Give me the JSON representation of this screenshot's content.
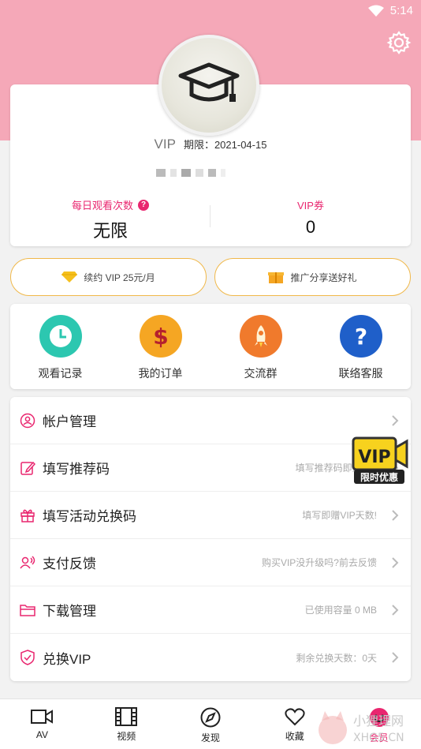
{
  "status": {
    "time": "5:14"
  },
  "profile": {
    "vip_label": "VIP",
    "expire_text": "期限：2021-04-15",
    "stats": [
      {
        "label": "每日观看次数",
        "value": "无限"
      },
      {
        "label": "VIP券",
        "value": "0"
      }
    ]
  },
  "promos": [
    {
      "label": "续约 VIP 25元/月",
      "icon": "diamond-icon"
    },
    {
      "label": "推广分享送好礼",
      "icon": "gift-box-icon"
    }
  ],
  "quick_actions": [
    {
      "label": "观看记录",
      "icon": "clock-icon",
      "color": "#2cc7b0"
    },
    {
      "label": "我的订单",
      "icon": "dollar-icon",
      "color": "#f5a623"
    },
    {
      "label": "交流群",
      "icon": "rocket-icon",
      "color": "#f07a2c"
    },
    {
      "label": "联络客服",
      "icon": "question-icon",
      "color": "#1f5fc9"
    }
  ],
  "menu": [
    {
      "label": "帐户管理",
      "hint": "",
      "icon": "user-icon"
    },
    {
      "label": "填写推荐码",
      "hint": "填写推荐码即赠VIP",
      "icon": "edit-icon"
    },
    {
      "label": "填写活动兑换码",
      "hint": "填写即赠VIP天数!",
      "icon": "gift-icon"
    },
    {
      "label": "支付反馈",
      "hint": "购买VIP没升级吗?前去反馈",
      "icon": "feedback-icon"
    },
    {
      "label": "下载管理",
      "hint": "已使用容量 0 MB",
      "icon": "folder-icon"
    },
    {
      "label": "兑换VIP",
      "hint": "剩余兑换天数：0天",
      "icon": "shield-icon"
    }
  ],
  "vip_badge": {
    "title": "VIP",
    "subtitle": "限时优惠"
  },
  "tabs": [
    {
      "label": "AV",
      "icon": "video-camera-icon"
    },
    {
      "label": "视频",
      "icon": "film-icon"
    },
    {
      "label": "发现",
      "icon": "compass-icon"
    },
    {
      "label": "收藏",
      "icon": "heart-icon"
    },
    {
      "label": "会员",
      "icon": "member-face-icon",
      "active": true
    }
  ],
  "watermark": {
    "text": "小狸理网",
    "sub": "XHG5.CN"
  },
  "colors": {
    "accent": "#e9266f",
    "header_pink": "#f5a8b8",
    "promo_border": "#f0b84a"
  }
}
